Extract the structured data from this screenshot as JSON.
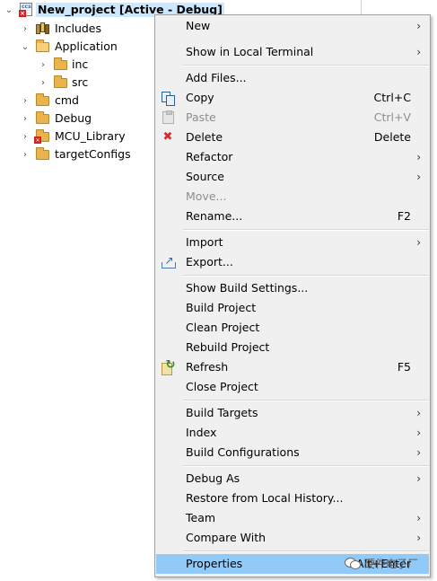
{
  "tree": {
    "root": {
      "label": "New_project  [Active - Debug]",
      "icon": "ccs-project-icon"
    },
    "items": [
      {
        "label": "Includes",
        "icon": "library-icon"
      },
      {
        "label": "Application",
        "icon": "folder-open-icon"
      },
      {
        "label": "inc",
        "icon": "folder-icon"
      },
      {
        "label": "src",
        "icon": "folder-icon"
      },
      {
        "label": "cmd",
        "icon": "folder-icon"
      },
      {
        "label": "Debug",
        "icon": "folder-icon"
      },
      {
        "label": "MCU_Library",
        "icon": "folder-error-icon"
      },
      {
        "label": "targetConfigs",
        "icon": "folder-icon"
      }
    ]
  },
  "menu": {
    "items": [
      {
        "label": "New",
        "submenu": true
      },
      {
        "label": "Show in Local Terminal",
        "submenu": true
      },
      {
        "label": "Add Files..."
      },
      {
        "label": "Copy",
        "shortcut": "Ctrl+C",
        "icon": "copy-icon"
      },
      {
        "label": "Paste",
        "shortcut": "Ctrl+V",
        "icon": "paste-icon",
        "disabled": true
      },
      {
        "label": "Delete",
        "shortcut": "Delete",
        "icon": "delete-icon"
      },
      {
        "label": "Refactor",
        "submenu": true
      },
      {
        "label": "Source",
        "submenu": true
      },
      {
        "label": "Move...",
        "disabled": true
      },
      {
        "label": "Rename...",
        "shortcut": "F2"
      },
      {
        "label": "Import",
        "submenu": true
      },
      {
        "label": "Export...",
        "icon": "export-icon"
      },
      {
        "label": "Show Build Settings..."
      },
      {
        "label": "Build Project"
      },
      {
        "label": "Clean Project"
      },
      {
        "label": "Rebuild Project"
      },
      {
        "label": "Refresh",
        "shortcut": "F5",
        "icon": "refresh-icon"
      },
      {
        "label": "Close Project"
      },
      {
        "label": "Build Targets",
        "submenu": true
      },
      {
        "label": "Index",
        "submenu": true
      },
      {
        "label": "Build Configurations",
        "submenu": true
      },
      {
        "label": "Debug As",
        "submenu": true
      },
      {
        "label": "Restore from Local History..."
      },
      {
        "label": "Team",
        "submenu": true
      },
      {
        "label": "Compare With",
        "submenu": true
      },
      {
        "label": "Properties",
        "shortcut": "Alt+Enter",
        "selected": true
      }
    ],
    "submenu_arrow": "›"
  },
  "watermark": {
    "text": "硬件电子厂"
  },
  "colors": {
    "selection": "#91c9f7",
    "root_highlight": "#cce8ff",
    "menu_bg": "#f0f0f0"
  }
}
